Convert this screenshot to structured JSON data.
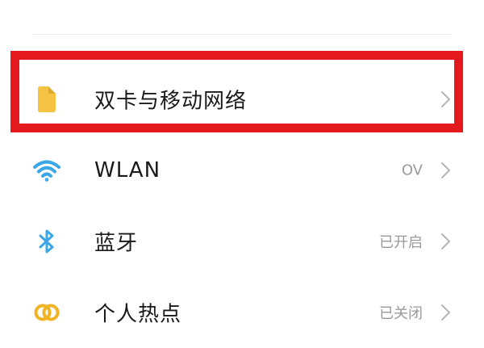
{
  "settings": {
    "items": [
      {
        "label": "双卡与移动网络",
        "value": "",
        "icon": "sim-card-icon",
        "icon_color": "#F5C242"
      },
      {
        "label": "WLAN",
        "value": "OV",
        "icon": "wifi-icon",
        "icon_color": "#3BA7E8"
      },
      {
        "label": "蓝牙",
        "value": "已开启",
        "icon": "bluetooth-icon",
        "icon_color": "#3BA7E8"
      },
      {
        "label": "个人热点",
        "value": "已关闭",
        "icon": "hotspot-icon",
        "icon_color": "#F0B323"
      }
    ]
  },
  "highlight": {
    "color": "#E3191E"
  },
  "chevron": {
    "icon": "chevron-right-icon",
    "color": "#B5B5B5"
  }
}
